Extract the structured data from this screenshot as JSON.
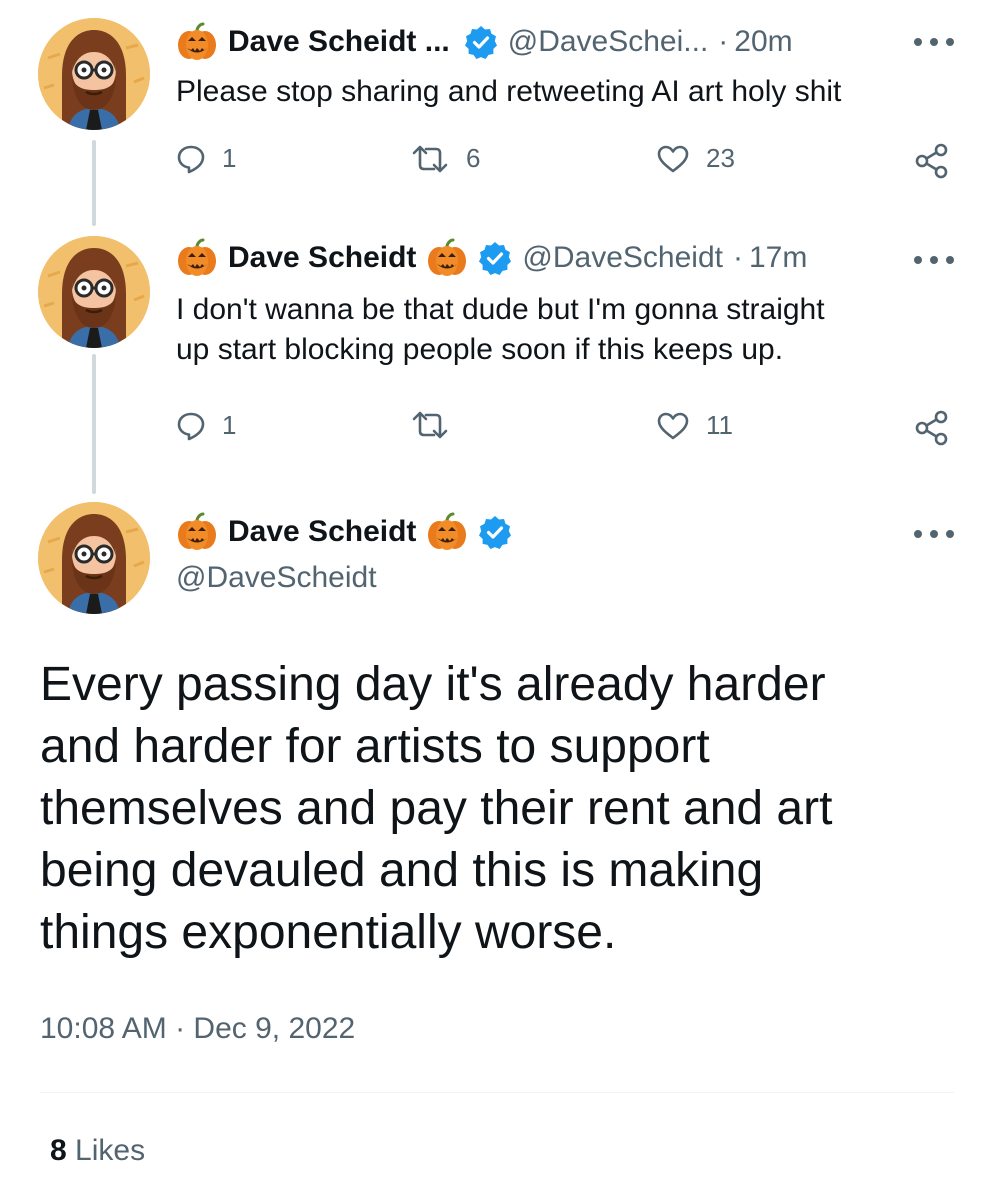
{
  "tweets": [
    {
      "name": "Dave Scheidt ...",
      "handle": "@DaveSchei...",
      "separator": "·",
      "time": "20m",
      "text": "Please stop sharing and retweeting AI art holy shit",
      "replies": "1",
      "retweets": "6",
      "likes": "23"
    },
    {
      "name": "Dave Scheidt",
      "handle": "@DaveScheidt",
      "separator": "·",
      "time": "17m",
      "text": "I don't wanna be that dude but I'm gonna straight\nup start blocking people soon if this keeps up.",
      "replies": "1",
      "retweets": "",
      "likes": "11"
    }
  ],
  "main": {
    "name": "Dave Scheidt",
    "handle": "@DaveScheidt",
    "text": "Every passing day it's already harder\nand harder for artists to support\nthemselves and pay their rent and art\nbeing devauled and this is making\nthings exponentially worse.",
    "timestamp": "10:08 AM · Dec 9, 2022",
    "likes_count": "8",
    "likes_label": "Likes"
  },
  "icons": {
    "pumpkin": "pumpkin-emoji-icon",
    "verified": "verified-badge-icon",
    "reply": "reply-icon",
    "retweet": "retweet-icon",
    "like": "heart-icon",
    "share": "share-icon",
    "more": "more-icon"
  },
  "colors": {
    "verified_blue": "#1d9bf0",
    "text": "#0f1419",
    "secondary": "#536471",
    "thread_line": "#cfd9de"
  }
}
